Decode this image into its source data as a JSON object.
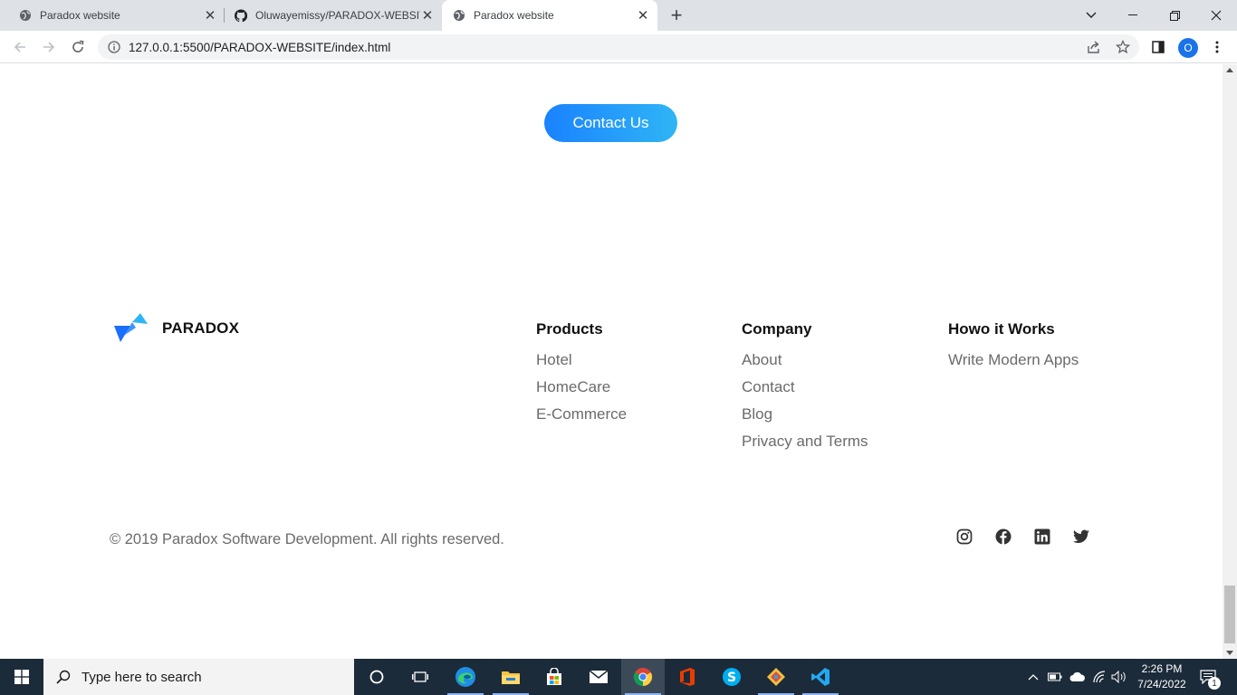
{
  "browser": {
    "tabs": [
      {
        "title": "Paradox website",
        "active": false
      },
      {
        "title": "Oluwayemissy/PARADOX-WEBSITE",
        "active": false
      },
      {
        "title": "Paradox website",
        "active": true
      }
    ],
    "url": "127.0.0.1:5500/PARADOX-WEBSITE/index.html",
    "profile_initial": "O"
  },
  "page": {
    "contact_button": "Contact Us",
    "brand_name": "PARADOX",
    "columns": [
      {
        "heading": "Products",
        "links": [
          "Hotel",
          "HomeCare",
          "E-Commerce"
        ]
      },
      {
        "heading": "Company",
        "links": [
          "About",
          "Contact",
          "Blog",
          "Privacy and Terms"
        ]
      },
      {
        "heading": "Howo it Works",
        "links": [
          "Write Modern Apps"
        ]
      }
    ],
    "copyright": "© 2019 Paradox Software Development. All rights reserved.",
    "social_icons": [
      "instagram-icon",
      "facebook-icon",
      "linkedin-icon",
      "twitter-icon"
    ],
    "accent_colors": {
      "button_start": "#1a82ff",
      "button_end": "#2fb5f5",
      "logo_light": "#2fb5f5",
      "logo_dark": "#1a6fff"
    }
  },
  "taskbar": {
    "search_placeholder": "Type here to search",
    "time": "2:26 PM",
    "date": "7/24/2022",
    "notification_count": "1"
  }
}
